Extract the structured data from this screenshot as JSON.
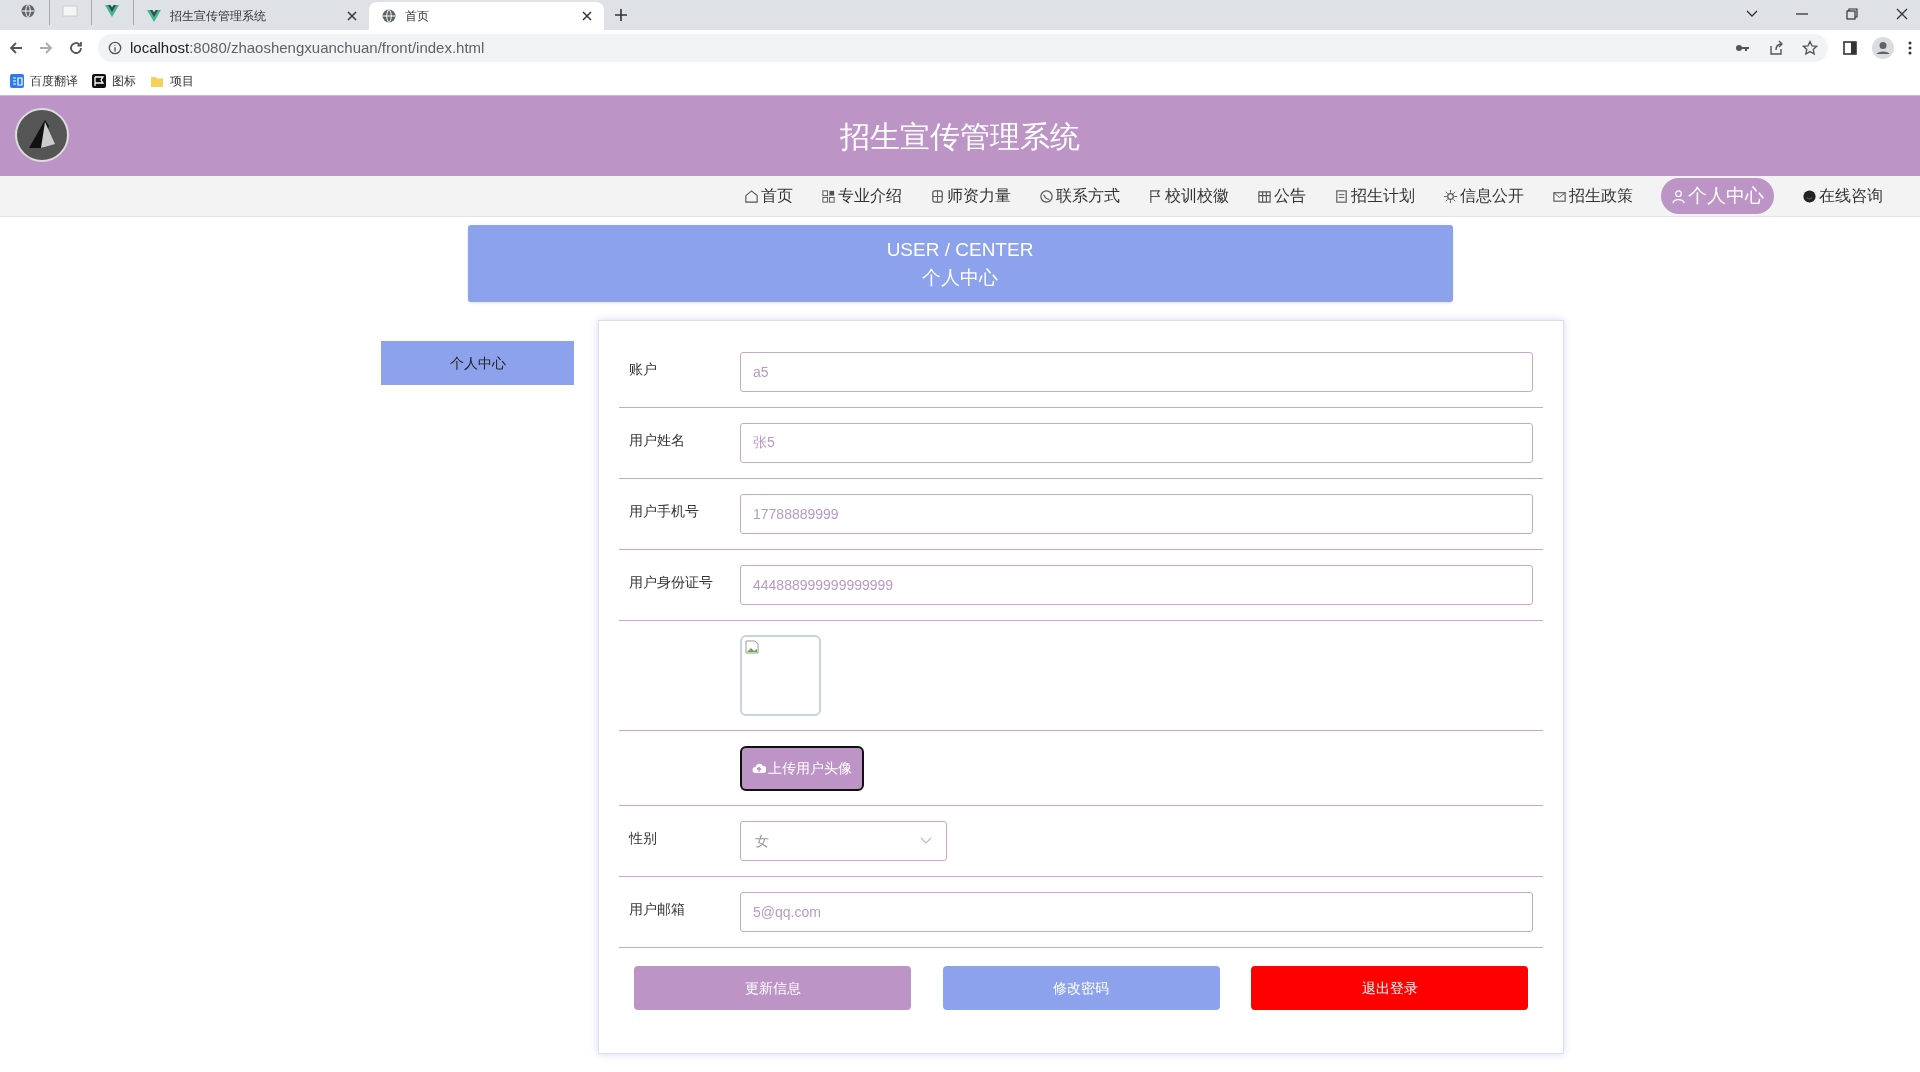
{
  "browser": {
    "tabs": [
      {
        "selected": false
      },
      {
        "selected": false
      },
      {
        "selected": false
      },
      {
        "title": "招生宣传管理系统",
        "selected": false
      },
      {
        "title": "首页",
        "selected": true
      }
    ],
    "address": {
      "host": "localhost",
      "path": ":8080/zhaoshengxuanchuan/front/index.html"
    },
    "bookmarks": [
      "百度翻译",
      "图标",
      "项目"
    ]
  },
  "header": {
    "title": "招生宣传管理系统"
  },
  "nav": [
    {
      "label": "首页",
      "selected": false
    },
    {
      "label": "专业介绍",
      "selected": false
    },
    {
      "label": "师资力量",
      "selected": false
    },
    {
      "label": "联系方式",
      "selected": false
    },
    {
      "label": "校训校徽",
      "selected": false
    },
    {
      "label": "公告",
      "selected": false
    },
    {
      "label": "招生计划",
      "selected": false
    },
    {
      "label": "信息公开",
      "selected": false
    },
    {
      "label": "招生政策",
      "selected": false
    },
    {
      "label": "个人中心",
      "selected": true
    },
    {
      "label": "在线咨询",
      "selected": false
    }
  ],
  "banner": {
    "title_en": "USER / CENTER",
    "title": "个人中心"
  },
  "sidebar": [
    {
      "label": "个人中心",
      "selected": true
    }
  ],
  "form": [
    {
      "kind": "text",
      "label": "账户",
      "value": "a5"
    },
    {
      "kind": "text",
      "label": "用户姓名",
      "value": "张5"
    },
    {
      "kind": "text",
      "label": "用户手机号",
      "value": "17788889999"
    },
    {
      "kind": "text",
      "label": "用户身份证号",
      "value": "444888999999999999"
    },
    {
      "kind": "image"
    },
    {
      "kind": "upload",
      "button": "上传用户头像"
    },
    {
      "kind": "select",
      "label": "性别",
      "value": "女"
    },
    {
      "kind": "text",
      "label": "用户邮箱",
      "value": "5@qq.com"
    }
  ],
  "actions": [
    {
      "kind": "update",
      "label": "更新信息"
    },
    {
      "kind": "password",
      "label": "修改密码"
    },
    {
      "kind": "logout",
      "label": "退出登录"
    }
  ]
}
